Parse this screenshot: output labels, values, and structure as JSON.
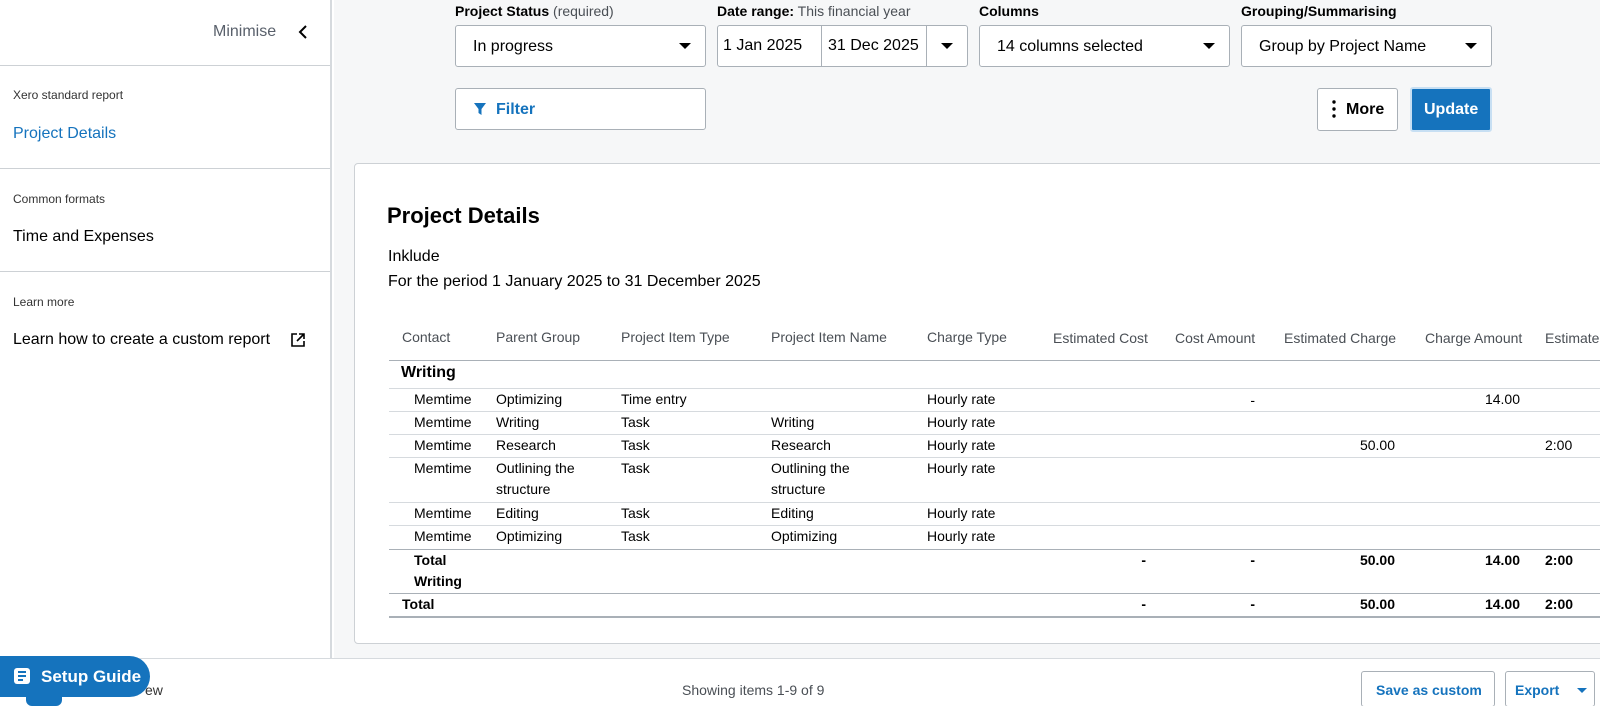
{
  "sidebar": {
    "minimise_label": "Minimise",
    "sections": [
      {
        "heading": "Xero standard report",
        "link": "Project Details",
        "active": true
      },
      {
        "heading": "Common formats",
        "link": "Time and Expenses",
        "active": false
      },
      {
        "heading": "Learn more",
        "link": "Learn how to create a custom report",
        "active": false
      }
    ]
  },
  "filters": {
    "project_status": {
      "label": "Project Status",
      "hint": "(required)",
      "value": "In progress"
    },
    "date_range": {
      "label": "Date range:",
      "hint": "This financial year",
      "from": "1 Jan 2025",
      "to": "31 Dec 2025"
    },
    "columns": {
      "label": "Columns",
      "value": "14 columns selected"
    },
    "grouping": {
      "label": "Grouping/Summarising",
      "value": "Group by Project Name"
    },
    "filter_label": "Filter",
    "more_label": "More",
    "update_label": "Update"
  },
  "report": {
    "title": "Project Details",
    "org": "Inklude",
    "period": "For the period 1 January 2025 to 31 December 2025",
    "columns": [
      "Contact",
      "Parent Group",
      "Project Item Type",
      "Project Item Name",
      "Charge Type",
      "Estimated Cost",
      "Cost Amount",
      "Estimated Charge",
      "Charge Amount",
      "Estimated"
    ],
    "group": "Writing",
    "rows": [
      {
        "contact": "Memtime",
        "parent": "Optimizing",
        "type": "Time entry",
        "name": "",
        "charge": "Hourly rate",
        "est_cost": "",
        "cost": "-",
        "est_charge": "",
        "charge_amt": "14.00",
        "estimated": ""
      },
      {
        "contact": "Memtime",
        "parent": "Writing",
        "type": "Task",
        "name": "Writing",
        "charge": "Hourly rate",
        "est_cost": "",
        "cost": "",
        "est_charge": "",
        "charge_amt": "",
        "estimated": ""
      },
      {
        "contact": "Memtime",
        "parent": "Research",
        "type": "Task",
        "name": "Research",
        "charge": "Hourly rate",
        "est_cost": "",
        "cost": "",
        "est_charge": "50.00",
        "charge_amt": "",
        "estimated": "2:00"
      },
      {
        "contact": "Memtime",
        "parent": "Outlining the structure",
        "parent_l1": "Outlining the",
        "parent_l2": "structure",
        "type": "Task",
        "name": "Outlining the structure",
        "name_l1": "Outlining the",
        "name_l2": "structure",
        "charge": "Hourly rate",
        "est_cost": "",
        "cost": "",
        "est_charge": "",
        "charge_amt": "",
        "estimated": ""
      },
      {
        "contact": "Memtime",
        "parent": "Editing",
        "type": "Task",
        "name": "Editing",
        "charge": "Hourly rate",
        "est_cost": "",
        "cost": "",
        "est_charge": "",
        "charge_amt": "",
        "estimated": ""
      },
      {
        "contact": "Memtime",
        "parent": "Optimizing",
        "type": "Task",
        "name": "Optimizing",
        "charge": "Hourly rate",
        "est_cost": "",
        "cost": "",
        "est_charge": "",
        "charge_amt": "",
        "estimated": ""
      }
    ],
    "group_total": {
      "label_l1": "Total",
      "label_l2": "Writing",
      "est_cost": "-",
      "cost": "-",
      "est_charge": "50.00",
      "charge_amt": "14.00",
      "estimated": "2:00"
    },
    "grand_total": {
      "label": "Total",
      "est_cost": "-",
      "cost": "-",
      "est_charge": "50.00",
      "charge_amt": "14.00",
      "estimated": "2:00"
    }
  },
  "footer": {
    "showing": "Showing items 1-9 of 9",
    "save_custom": "Save as custom",
    "export": "Export",
    "setup_guide": "Setup Guide",
    "partial_text": "ew"
  },
  "colors": {
    "accent": "#1573bd",
    "border": "#a9b0b7",
    "background": "#f6f7f8"
  }
}
